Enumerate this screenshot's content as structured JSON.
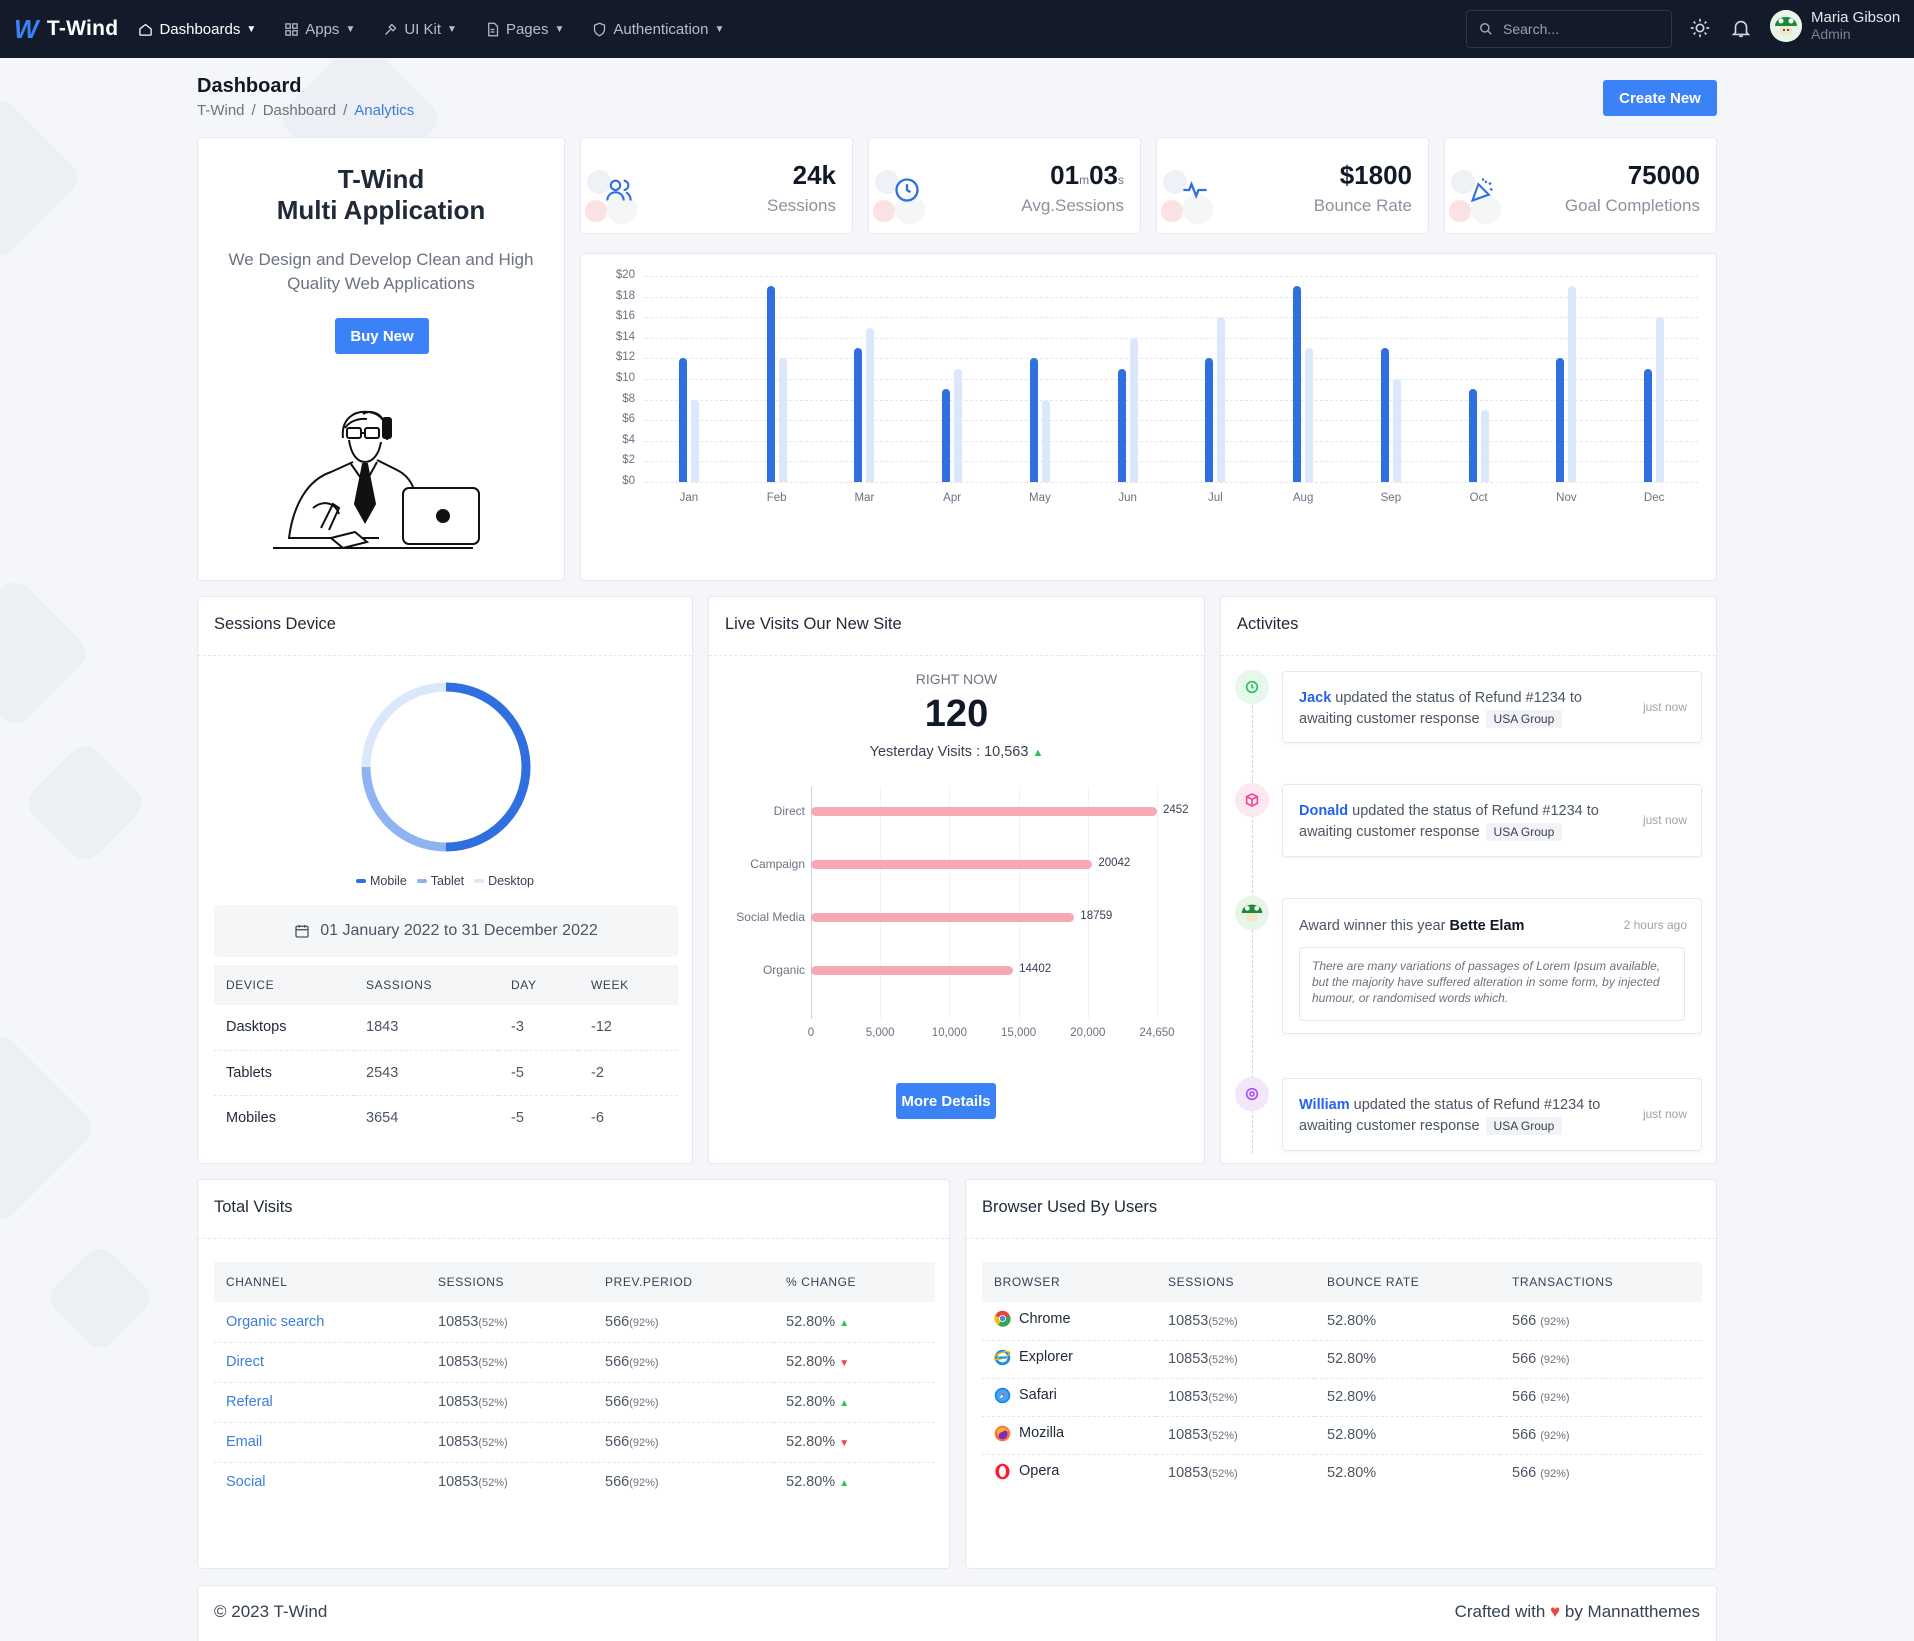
{
  "brand": {
    "name": "T-Wind",
    "mark": "W"
  },
  "nav": [
    {
      "label": "Dashboards",
      "icon": "home-icon"
    },
    {
      "label": "Apps",
      "icon": "grid-icon"
    },
    {
      "label": "UI Kit",
      "icon": "tools-icon"
    },
    {
      "label": "Pages",
      "icon": "file-icon"
    },
    {
      "label": "Authentication",
      "icon": "shield-icon"
    }
  ],
  "search": {
    "placeholder": "Search..."
  },
  "user": {
    "name": "Maria Gibson",
    "role": "Admin"
  },
  "page": {
    "title": "Dashboard",
    "crumbs": [
      "T-Wind",
      "Dashboard",
      "Analytics"
    ],
    "create_label": "Create New"
  },
  "hero": {
    "line1": "T-Wind",
    "line2": "Multi Application",
    "desc": "We Design and Develop Clean and High Quality Web Applications",
    "button": "Buy New"
  },
  "stats": [
    {
      "value": "24k",
      "label": "Sessions",
      "icon": "users-icon"
    },
    {
      "value_a": "01",
      "unit_a": "m",
      "value_b": "03",
      "unit_b": "s",
      "label": "Avg.Sessions",
      "icon": "clock-icon"
    },
    {
      "value": "$1800",
      "label": "Bounce Rate",
      "icon": "activity-icon"
    },
    {
      "value": "75000",
      "label": "Goal Completions",
      "icon": "party-icon"
    }
  ],
  "colors": {
    "primary": "#2f6fe0",
    "secondary": "#dbe7fb",
    "accent": "#3b82f6",
    "pink_bar": "#f8a8b2"
  },
  "chart_data": [
    {
      "type": "bar",
      "categories": [
        "Jan",
        "Feb",
        "Mar",
        "Apr",
        "May",
        "Jun",
        "Jul",
        "Aug",
        "Sep",
        "Oct",
        "Nov",
        "Dec"
      ],
      "series": [
        {
          "values": [
            12,
            19,
            13,
            9,
            12,
            11,
            12,
            19,
            13,
            9,
            12,
            11
          ]
        },
        {
          "values": [
            8,
            12,
            15,
            11,
            8,
            14,
            16,
            13,
            10,
            7,
            19,
            16
          ]
        }
      ],
      "yticks": [
        "$0",
        "$2",
        "$4",
        "$6",
        "$8",
        "$10",
        "$12",
        "$14",
        "$16",
        "$18",
        "$20"
      ],
      "ylim": [
        0,
        20
      ],
      "grid": true
    },
    {
      "type": "bar",
      "orientation": "horizontal",
      "categories": [
        "Direct",
        "Campaign",
        "Social Media",
        "Organic"
      ],
      "values": [
        2452,
        20042,
        18759,
        14402
      ],
      "display_values": [
        24650,
        20042,
        18759,
        14402
      ],
      "xticks": [
        "0",
        "5,000",
        "10,000",
        "15,000",
        "20,000",
        "24,650"
      ],
      "xlim": [
        0,
        24650
      ]
    },
    {
      "type": "pie",
      "donut": true,
      "categories": [
        "Mobile",
        "Tablet",
        "Desktop"
      ],
      "values": [
        50,
        25,
        25
      ]
    }
  ],
  "sessions_device": {
    "title": "Sessions Device",
    "legend": [
      "Mobile",
      "Tablet",
      "Desktop"
    ],
    "date_range": "01 January 2022 to 31 December 2022",
    "headers": [
      "DEVICE",
      "SASSIONS",
      "DAY",
      "WEEK"
    ],
    "rows": [
      [
        "Dasktops",
        "1843",
        "-3",
        "-12"
      ],
      [
        "Tablets",
        "2543",
        "-5",
        "-2"
      ],
      [
        "Mobiles",
        "3654",
        "-5",
        "-6"
      ]
    ]
  },
  "live": {
    "title": "Live Visits Our New Site",
    "right_now_label": "RIGHT NOW",
    "right_now_value": "120",
    "yesterday": "Yesterday Visits : 10,563",
    "bar_labels": [
      "2452",
      "20042",
      "18759",
      "14402"
    ],
    "button": "More Details"
  },
  "activities": {
    "title": "Activites",
    "items": [
      {
        "name": "Jack",
        "text": "updated the status of Refund #1234 to awaiting customer response",
        "tag": "USA Group",
        "time": "just now"
      },
      {
        "name": "Donald",
        "text": "updated the status of Refund #1234 to awaiting customer response",
        "tag": "USA Group",
        "time": "just now"
      },
      {
        "prefix": "Award winner this year",
        "name": "Bette Elam",
        "time": "2 hours ago",
        "quote": "There are many variations of passages of Lorem Ipsum available, but the majority have suffered alteration in some form, by injected humour, or randomised words which."
      },
      {
        "name": "William",
        "text": "updated the status of Refund #1234 to awaiting customer response",
        "tag": "USA Group",
        "time": "just now"
      }
    ]
  },
  "total_visits": {
    "title": "Total Visits",
    "headers": [
      "CHANNEL",
      "SESSIONS",
      "PREV.PERIOD",
      "% CHANGE"
    ],
    "rows": [
      {
        "channel": "Organic search",
        "sessions": "10853",
        "sessions_pct": "(52%)",
        "prev": "566",
        "prev_pct": "(92%)",
        "change": "52.80%",
        "trend": "up"
      },
      {
        "channel": "Direct",
        "sessions": "10853",
        "sessions_pct": "(52%)",
        "prev": "566",
        "prev_pct": "(92%)",
        "change": "52.80%",
        "trend": "down"
      },
      {
        "channel": "Referal",
        "sessions": "10853",
        "sessions_pct": "(52%)",
        "prev": "566",
        "prev_pct": "(92%)",
        "change": "52.80%",
        "trend": "up"
      },
      {
        "channel": "Email",
        "sessions": "10853",
        "sessions_pct": "(52%)",
        "prev": "566",
        "prev_pct": "(92%)",
        "change": "52.80%",
        "trend": "down"
      },
      {
        "channel": "Social",
        "sessions": "10853",
        "sessions_pct": "(52%)",
        "prev": "566",
        "prev_pct": "(92%)",
        "change": "52.80%",
        "trend": "up"
      }
    ]
  },
  "browsers": {
    "title": "Browser Used By Users",
    "headers": [
      "BROWSER",
      "SESSIONS",
      "BOUNCE RATE",
      "TRANSACTIONS"
    ],
    "rows": [
      {
        "name": "Chrome",
        "icon": "chrome-icon",
        "sessions": "10853",
        "sessions_pct": "(52%)",
        "bounce": "52.80%",
        "tx": "566",
        "tx_pct": "(92%)"
      },
      {
        "name": "Explorer",
        "icon": "explorer-icon",
        "sessions": "10853",
        "sessions_pct": "(52%)",
        "bounce": "52.80%",
        "tx": "566",
        "tx_pct": "(92%)"
      },
      {
        "name": "Safari",
        "icon": "safari-icon",
        "sessions": "10853",
        "sessions_pct": "(52%)",
        "bounce": "52.80%",
        "tx": "566",
        "tx_pct": "(92%)"
      },
      {
        "name": "Mozilla",
        "icon": "firefox-icon",
        "sessions": "10853",
        "sessions_pct": "(52%)",
        "bounce": "52.80%",
        "tx": "566",
        "tx_pct": "(92%)"
      },
      {
        "name": "Opera",
        "icon": "opera-icon",
        "sessions": "10853",
        "sessions_pct": "(52%)",
        "bounce": "52.80%",
        "tx": "566",
        "tx_pct": "(92%)"
      }
    ]
  },
  "footer": {
    "left": "© 2023 T-Wind",
    "right_a": "Crafted with",
    "heart": "♥",
    "right_b": "by Mannatthemes"
  }
}
